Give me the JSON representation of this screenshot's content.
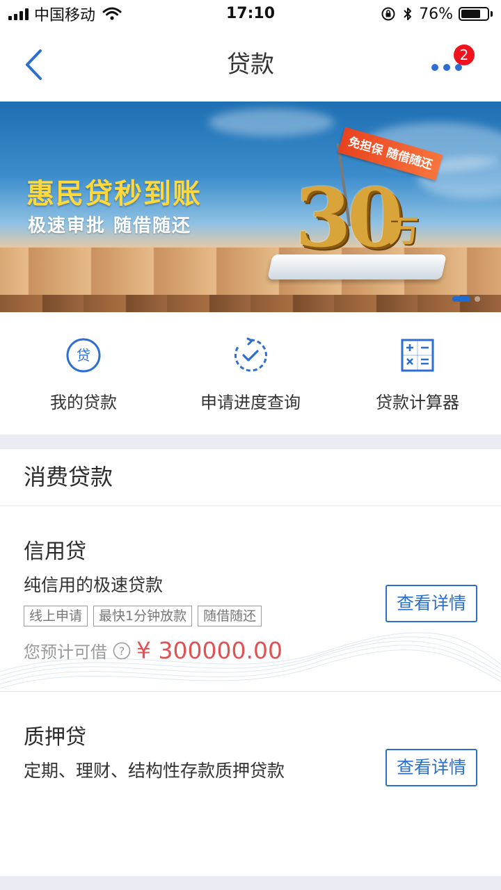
{
  "status_bar": {
    "carrier": "中国移动",
    "time": "17:10",
    "battery": "76%",
    "battery_level": 0.76
  },
  "nav": {
    "title": "贷款",
    "badge_count": "2"
  },
  "banner": {
    "title": "惠民贷秒到账",
    "subtitle": "极速审批 随借随还",
    "flag_text": "免担保 随借随还",
    "amount_number": "30",
    "amount_unit": "万",
    "active_slide": 1
  },
  "quick_actions": [
    {
      "label": "我的贷款",
      "icon": "loan-coin-icon"
    },
    {
      "label": "申请进度查询",
      "icon": "progress-check-icon"
    },
    {
      "label": "贷款计算器",
      "icon": "calculator-icon"
    }
  ],
  "section": {
    "title": "消费贷款"
  },
  "products": [
    {
      "title": "信用贷",
      "desc": "纯信用的极速贷款",
      "tags": [
        "线上申请",
        "最快1分钟放款",
        "随借随还"
      ],
      "estimate_label": "您预计可借",
      "amount": "¥ 300000.00",
      "button": "查看详情"
    },
    {
      "title": "质押贷",
      "desc": "定期、理财、结构性存款质押贷款",
      "button": "查看详情"
    }
  ],
  "colors": {
    "accent": "#2a6fc8",
    "amount": "#e15252",
    "badge": "#f0131d"
  }
}
